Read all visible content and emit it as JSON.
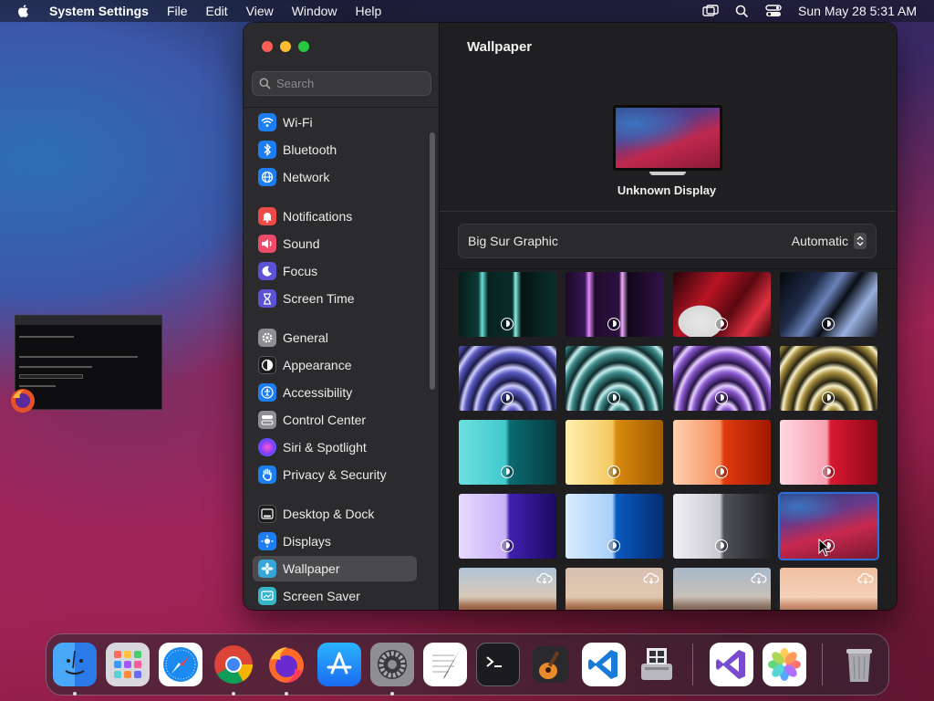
{
  "menubar": {
    "app_name": "System Settings",
    "menus": [
      "File",
      "Edit",
      "View",
      "Window",
      "Help"
    ],
    "clock": "Sun May 28  5:31 AM"
  },
  "sidebar": {
    "search_placeholder": "Search",
    "items": [
      {
        "label": "Wi-Fi",
        "icon": "wifi-icon",
        "color": "#1c7ef0"
      },
      {
        "label": "Bluetooth",
        "icon": "bluetooth-icon",
        "color": "#1c7ef0"
      },
      {
        "label": "Network",
        "icon": "globe-icon",
        "color": "#1c7ef0"
      },
      {
        "label": "Notifications",
        "icon": "bell-icon",
        "color": "#ee4a4a"
      },
      {
        "label": "Sound",
        "icon": "speaker-icon",
        "color": "#ee4a6a"
      },
      {
        "label": "Focus",
        "icon": "moon-icon",
        "color": "#5b52d6"
      },
      {
        "label": "Screen Time",
        "icon": "hourglass-icon",
        "color": "#5b52d6"
      },
      {
        "label": "General",
        "icon": "gear-icon",
        "color": "#8e8e93"
      },
      {
        "label": "Appearance",
        "icon": "appearance-icon",
        "color": "#1c1c1e"
      },
      {
        "label": "Accessibility",
        "icon": "accessibility-icon",
        "color": "#1c7ef0"
      },
      {
        "label": "Control Center",
        "icon": "control-center-icon",
        "color": "#8e8e93"
      },
      {
        "label": "Siri & Spotlight",
        "icon": "siri-icon",
        "color": "#b03cd0"
      },
      {
        "label": "Privacy & Security",
        "icon": "hand-icon",
        "color": "#1c7ef0"
      },
      {
        "label": "Desktop & Dock",
        "icon": "desktop-dock-icon",
        "color": "#1c1c1e"
      },
      {
        "label": "Displays",
        "icon": "displays-icon",
        "color": "#1c7ef0"
      },
      {
        "label": "Wallpaper",
        "icon": "wallpaper-icon",
        "color": "#36a5d8"
      },
      {
        "label": "Screen Saver",
        "icon": "screen-saver-icon",
        "color": "#36b5c8"
      }
    ],
    "selected": "Wallpaper"
  },
  "content": {
    "title": "Wallpaper",
    "display_name": "Unknown Display",
    "wallpaper_name": "Big Sur Graphic",
    "mode": "Automatic"
  },
  "dock": {
    "apps": [
      "Finder",
      "Launchpad",
      "Safari",
      "Google Chrome",
      "Firefox",
      "App Store",
      "System Settings",
      "TextEdit",
      "Terminal",
      "GarageBand",
      "Visual Studio Code",
      "Boot Camp Assistant",
      "Visual Studio",
      "Photos",
      "Trash"
    ]
  }
}
